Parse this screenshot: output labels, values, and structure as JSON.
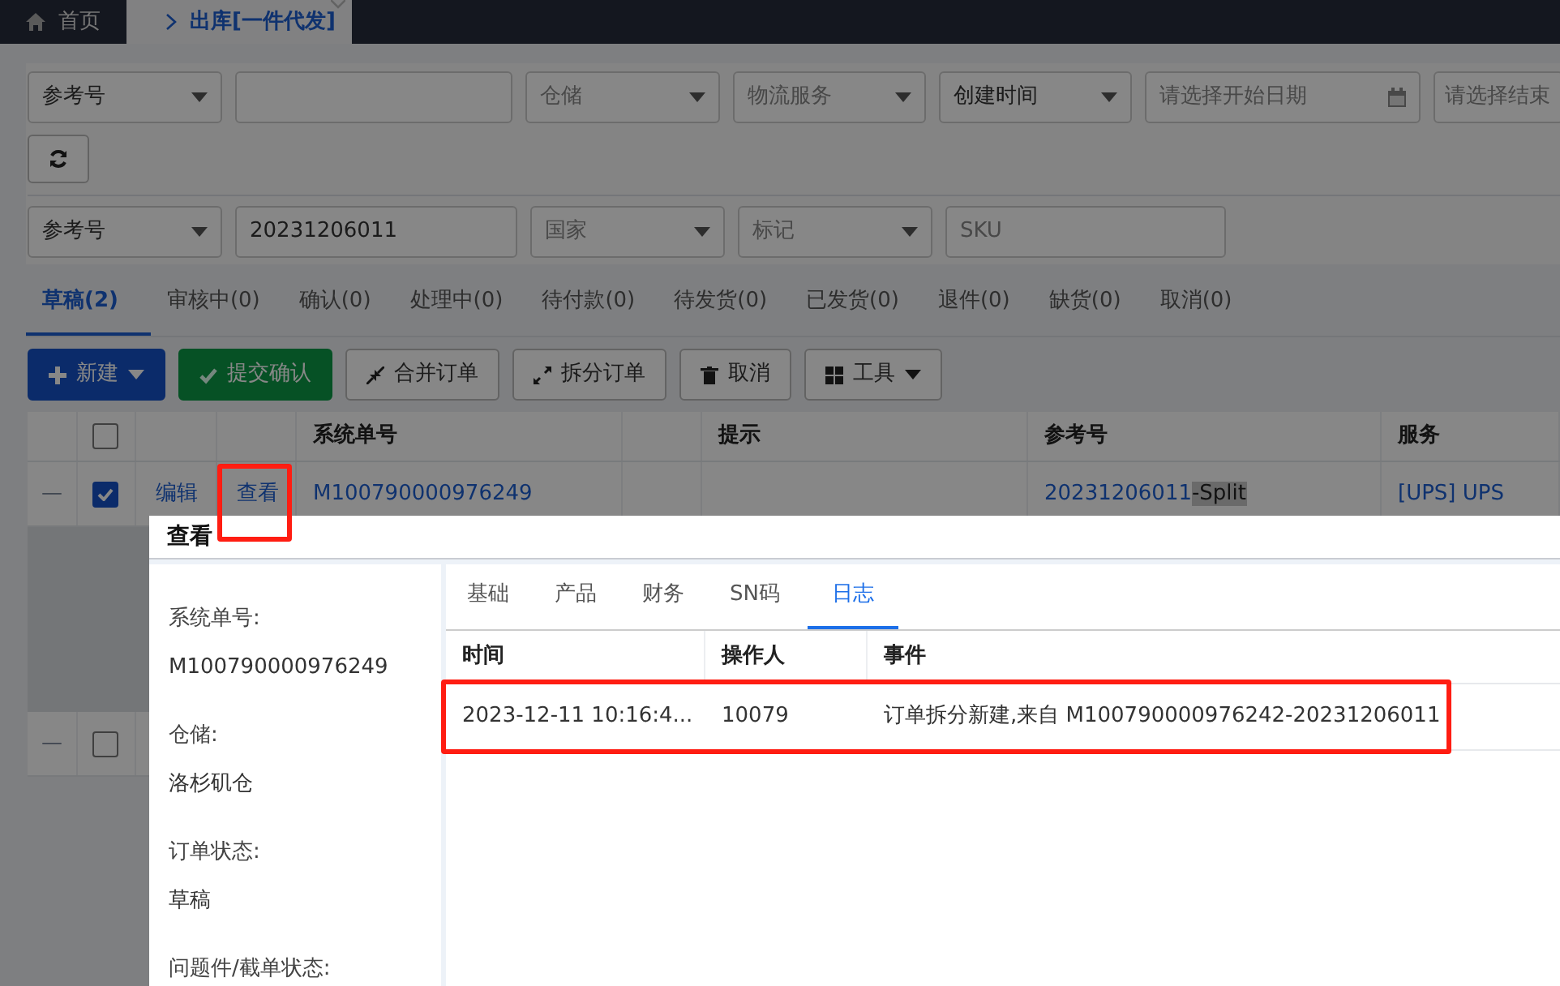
{
  "top_tabs": [
    {
      "label": "首页",
      "selected": false,
      "closable": false
    },
    {
      "label": "出库[一件代发]",
      "selected": true,
      "closable": true
    }
  ],
  "filters": {
    "rows": [
      [
        {
          "kind": "select",
          "value": "参考号"
        },
        {
          "kind": "input"
        },
        {
          "kind": "select",
          "placeholder": "仓储"
        },
        {
          "kind": "select",
          "placeholder": "物流服务"
        },
        {
          "kind": "select",
          "value": "创建时间"
        },
        {
          "kind": "date",
          "placeholder": "请选择开始日期"
        },
        {
          "kind": "date",
          "placeholder": "请选择结束"
        }
      ],
      [
        {
          "kind": "refresh"
        }
      ],
      [
        {
          "kind": "select",
          "value": "参考号"
        },
        {
          "kind": "input",
          "value": "20231206011"
        },
        {
          "kind": "select",
          "placeholder": "国家"
        },
        {
          "kind": "select",
          "placeholder": "标记"
        },
        {
          "kind": "input",
          "placeholder": "SKU"
        }
      ]
    ]
  },
  "status_tabs": [
    {
      "label": "草稿(2)",
      "selected": true
    },
    {
      "label": "审核中(0)",
      "selected": false
    },
    {
      "label": "确认(0)",
      "selected": false
    },
    {
      "label": "处理中(0)",
      "selected": false
    },
    {
      "label": "待付款(0)",
      "selected": false
    },
    {
      "label": "待发货(0)",
      "selected": false
    },
    {
      "label": "已发货(0)",
      "selected": false
    },
    {
      "label": "退件(0)",
      "selected": false
    },
    {
      "label": "缺货(0)",
      "selected": false
    },
    {
      "label": "取消(0)",
      "selected": false
    }
  ],
  "toolbar": [
    {
      "label": "新建",
      "kind": "primary",
      "dropdown": true
    },
    {
      "label": "提交确认",
      "kind": "success",
      "dropdown": false
    },
    {
      "label": "合并订单",
      "kind": "default",
      "dropdown": false
    },
    {
      "label": "拆分订单",
      "kind": "default",
      "dropdown": false
    },
    {
      "label": "取消",
      "kind": "default",
      "dropdown": false
    },
    {
      "label": "工具",
      "kind": "default",
      "dropdown": true
    }
  ],
  "table": {
    "header_checked": false,
    "columns": [
      "系统单号",
      "提示",
      "参考号",
      "服务"
    ],
    "rows": [
      {
        "checked": true,
        "expand": "—",
        "edit": "编辑",
        "view": "查看",
        "view_highlight": true,
        "system_no": "M100790000976249",
        "ref": "20231206011",
        "ref_selected_part": "-Split",
        "service": "[UPS] UPS"
      },
      {
        "checked": false,
        "expand": "—"
      }
    ]
  },
  "modal": {
    "title": "查看",
    "fields": [
      {
        "label": "系统单号:",
        "value": "M100790000976249"
      },
      {
        "label": "仓储:",
        "value": "洛杉矶仓"
      },
      {
        "label": "订单状态:",
        "value": "草稿"
      },
      {
        "label": "问题件/截单状态:"
      }
    ],
    "tabs": [
      {
        "label": "基础",
        "selected": false
      },
      {
        "label": "产品",
        "selected": false
      },
      {
        "label": "财务",
        "selected": false
      },
      {
        "label": "SN码",
        "selected": false
      },
      {
        "label": "日志",
        "selected": true
      }
    ],
    "log_columns": [
      "时间",
      "操作人",
      "事件"
    ],
    "log_rows": [
      {
        "highlight": true,
        "cells": [
          "2023-12-11 10:16:4...",
          "10079",
          "订单拆分新建,来自 M100790000976242-20231206011"
        ]
      }
    ]
  }
}
